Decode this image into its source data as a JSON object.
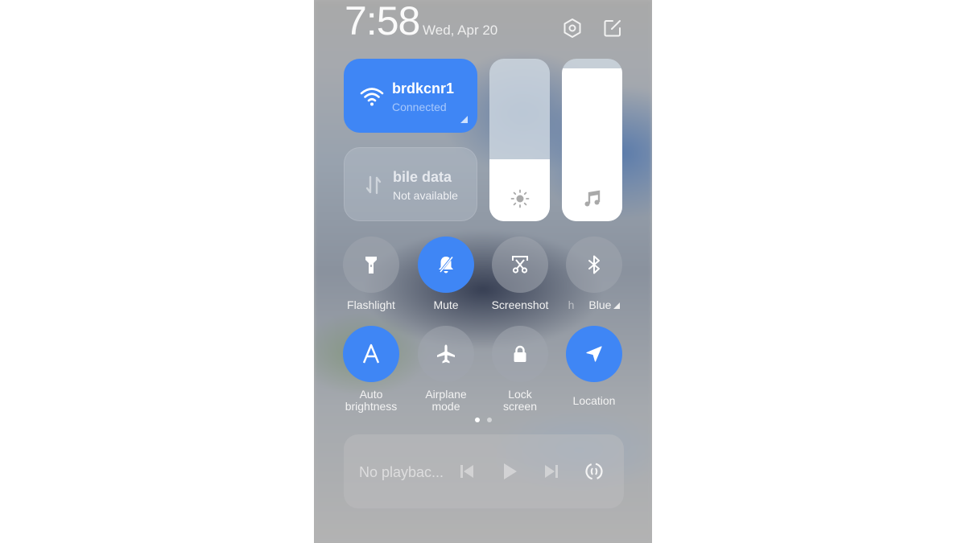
{
  "header": {
    "time": "7:58",
    "date": "Wed, Apr 20",
    "settings_icon": "gear-hexagon-icon",
    "edit_icon": "edit-icon"
  },
  "wifi": {
    "name": "brdkcnr1",
    "status": "Connected",
    "icon": "wifi-icon",
    "active": true
  },
  "mobile_data": {
    "title": "bile data",
    "status": "Not available",
    "icon": "mobile-data-icon",
    "active": false
  },
  "sliders": {
    "brightness": {
      "level_percent": 38,
      "icon": "sun-icon"
    },
    "volume": {
      "level_percent": 94,
      "icon": "music-note-icon"
    }
  },
  "toggles": [
    {
      "label": "Flashlight",
      "icon": "flashlight-icon",
      "active": false
    },
    {
      "label": "Mute",
      "icon": "bell-off-icon",
      "active": true
    },
    {
      "label": "Screenshot",
      "icon": "scissors-icon",
      "active": false
    },
    {
      "label_fragment_left": "h",
      "label": "Blue",
      "icon": "bluetooth-icon",
      "active": false
    },
    {
      "label": "Auto\nbrightness",
      "label_line1": "Auto",
      "label_line2": "brightness",
      "icon": "auto-brightness-icon",
      "active": true
    },
    {
      "label_line1": "Airplane",
      "label_line2": "mode",
      "icon": "airplane-icon",
      "active": false
    },
    {
      "label_line1": "Lock",
      "label_line2": "screen",
      "icon": "lock-icon",
      "active": false
    },
    {
      "label": "Location",
      "icon": "location-icon",
      "active": true
    }
  ],
  "pager": {
    "pages": 2,
    "current": 1
  },
  "media": {
    "text": "No playbac...",
    "controls": [
      "previous",
      "play",
      "next",
      "cast"
    ]
  },
  "colors": {
    "accent": "#3f86f5",
    "inactive_tile": "#a0a5af",
    "background": "#b3b3b3"
  }
}
